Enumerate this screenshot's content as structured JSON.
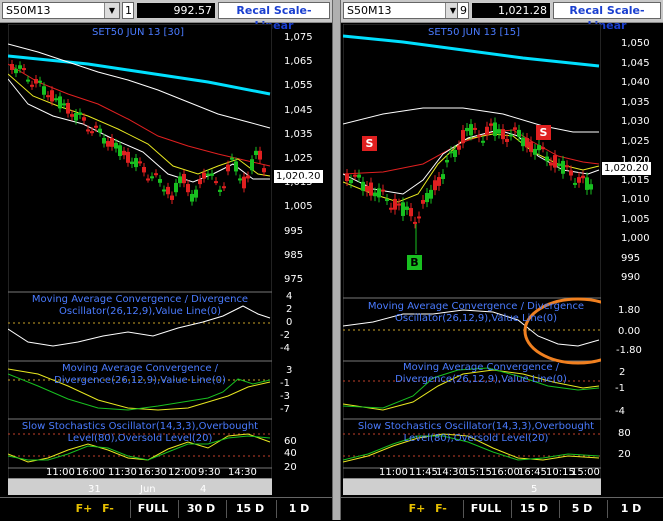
{
  "left": {
    "symbol": "S50M13",
    "interval": "1",
    "last_price": "992.57",
    "recal_label": "Recal Scale-Linear",
    "title": "SET50 JUN 13   [30]",
    "last_box": "1,020.20",
    "yticks": [
      "1,075",
      "1,065",
      "1,055",
      "1,045",
      "1,035",
      "1,025",
      "1,015",
      "1,005",
      "995",
      "985",
      "975"
    ],
    "macd_label": "Moving Average Convergence / Divergence Oscillator(26,12,9),Value Line(0)",
    "macd_ticks": [
      "4",
      "2",
      "0",
      "-2",
      "-4"
    ],
    "macd2_label": "Moving Average Convergence / Divergence(26,12,9),Value Line(0)",
    "macd2_ticks": [
      "3",
      "-1",
      "-3",
      "-7"
    ],
    "stoch_label": "Slow Stochastics Oscillator(14,3,3),Overbought Level(80),Oversold Level(20)",
    "stoch_ticks": [
      "60",
      "40",
      "20"
    ],
    "time_ticks": [
      "11:00",
      "16:00",
      "11:30",
      "16:30",
      "12:00",
      "9:30",
      "14:30"
    ],
    "date_ticks": [
      "31",
      "Jun",
      "4"
    ],
    "buttons": [
      "F+",
      "F-",
      "FULL",
      "30 D",
      "15 D",
      "1 D"
    ]
  },
  "right": {
    "symbol": "S50M13",
    "interval": "9",
    "last_price": "1,021.28",
    "recal_label": "Recal Scale-Linear",
    "title": "SET50 JUN 13   [15]",
    "last_box": "1,020.20",
    "yticks": [
      "1,050",
      "1,045",
      "1,040",
      "1,035",
      "1,030",
      "1,025",
      "1,020",
      "1,015",
      "1,010",
      "1,005",
      "1,000",
      "995",
      "990"
    ],
    "macd_label": "Moving Average Convergence / Divergence Oscillator(26,12,9),Value Line(0)",
    "macd_ticks": [
      "1.80",
      "0.00",
      "-1.80"
    ],
    "macd2_label": "Moving Average Convergence / Divergence(26,12,9),Value Line(0)",
    "macd2_ticks": [
      "2",
      "-1",
      "-4"
    ],
    "stoch_label": "Slow Stochastics Oscillator(14,3,3),Overbought Level(80),Oversold Level(20)",
    "stoch_ticks": [
      "80",
      "20"
    ],
    "time_ticks": [
      "11:00",
      "11:45",
      "14:30",
      "15:15",
      "16:00",
      "16:45",
      "10:15",
      "15:00"
    ],
    "date_ticks": [
      "5"
    ],
    "signals": [
      "S",
      "S",
      "B"
    ],
    "buttons": [
      "F+",
      "F-",
      "FULL",
      "15 D",
      "5 D",
      "1 D"
    ]
  },
  "colors": {
    "candle_up": "#18c020",
    "candle_down": "#e02020",
    "ema": "#00e0ff",
    "ma_red": "#e02020",
    "ma_yellow": "#e8e820",
    "ma_white": "#ffffff",
    "accent_blue": "#4a7bff",
    "highlight": "#f08020"
  }
}
